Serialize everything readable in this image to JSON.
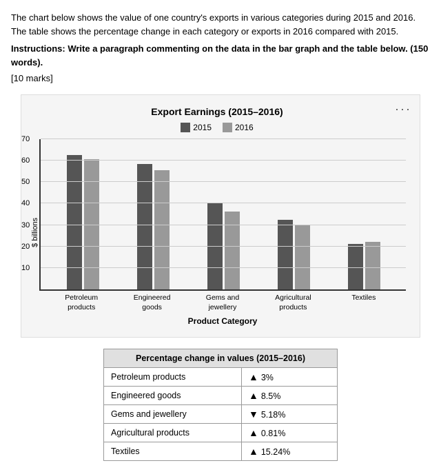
{
  "intro": {
    "description": "The chart below shows the value of one country's exports in various categories during 2015 and 2016. The table shows the percentage change in each category or exports in 2016 compared with 2015.",
    "instructions_label": "Instructions: Write a paragraph commenting on the data in the bar graph and the table below. (150 words).",
    "marks": "[10 marks]"
  },
  "chart": {
    "title": "Export Earnings (2015–2016)",
    "legend": {
      "label_2015": "2015",
      "label_2016": "2016"
    },
    "y_axis_label": "$ billions",
    "x_axis_title": "Product Category",
    "y_ticks": [
      10,
      20,
      30,
      40,
      50,
      60,
      70
    ],
    "bar_groups": [
      {
        "label": "Petroleum\nproducts",
        "value_2015": 62,
        "value_2016": 60
      },
      {
        "label": "Engineered\ngoods",
        "value_2015": 58,
        "value_2016": 55
      },
      {
        "label": "Gems and\njewellery",
        "value_2015": 40,
        "value_2016": 36
      },
      {
        "label": "Agricultural\nproducts",
        "value_2015": 32,
        "value_2016": 30
      },
      {
        "label": "Textiles",
        "value_2015": 21,
        "value_2016": 22
      }
    ],
    "three_dots": "···"
  },
  "table": {
    "header": "Percentage change in values (2015–2016)",
    "rows": [
      {
        "category": "Petroleum products",
        "direction": "up",
        "value": "3%"
      },
      {
        "category": "Engineered goods",
        "direction": "up",
        "value": "8.5%"
      },
      {
        "category": "Gems and jewellery",
        "direction": "down",
        "value": "5.18%"
      },
      {
        "category": "Agricultural products",
        "direction": "up",
        "value": "0.81%"
      },
      {
        "category": "Textiles",
        "direction": "up",
        "value": "15.24%"
      }
    ]
  }
}
